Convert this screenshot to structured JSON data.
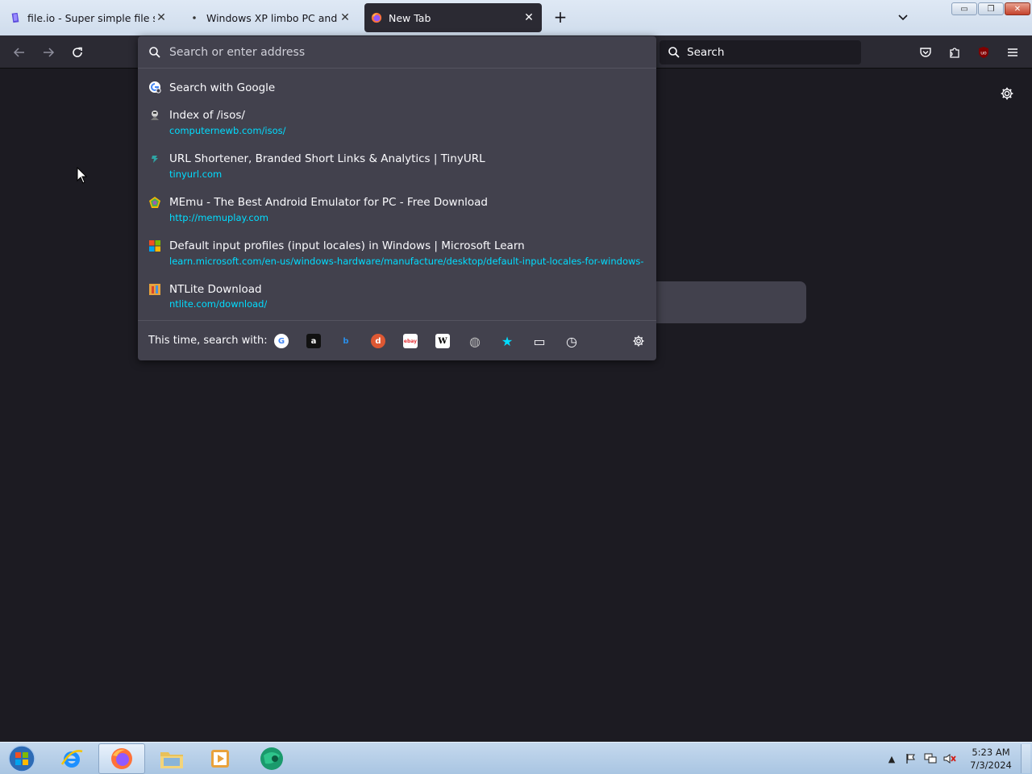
{
  "tabs": [
    {
      "title": "file.io - Super simple file sharing",
      "close": "✕"
    },
    {
      "title": "Windows XP limbo PC and JSO",
      "close": "✕"
    },
    {
      "title": "New Tab",
      "close": "✕",
      "active": true
    }
  ],
  "newtab_label": "+",
  "window_controls": {
    "minimize": "▭",
    "restore": "❐",
    "close": "✕"
  },
  "nav": {
    "search_label": "Search"
  },
  "urlbar": {
    "placeholder": "Search or enter address",
    "results": [
      {
        "title": "Search with Google",
        "url": "",
        "icon": "google-icon"
      },
      {
        "title": "Index of /isos/",
        "url": "computernewb.com/isos/",
        "icon": "site-icon"
      },
      {
        "title": "URL Shortener, Branded Short Links & Analytics | TinyURL",
        "url": "tinyurl.com",
        "icon": "tinyurl-icon"
      },
      {
        "title": "MEmu - The Best Android Emulator for PC - Free Download",
        "url": "http://memuplay.com",
        "icon": "memu-icon"
      },
      {
        "title": "Default input profiles (input locales) in Windows | Microsoft Learn",
        "url": "learn.microsoft.com/en-us/windows-hardware/manufacture/desktop/default-input-locales-for-windows-language-packs",
        "icon": "microsoft-icon"
      },
      {
        "title": "NTLite Download",
        "url": "ntlite.com/download/",
        "icon": "ntlite-icon"
      }
    ],
    "oneoff_label": "This time, search with:",
    "engines": [
      {
        "name": "google-engine-icon",
        "glyph": "G",
        "color": "#4285f4"
      },
      {
        "name": "amazon-engine-icon",
        "glyph": "a",
        "color": "#ffffff"
      },
      {
        "name": "bing-engine-icon",
        "glyph": "b",
        "color": "#2a8ee8"
      },
      {
        "name": "duckduckgo-engine-icon",
        "glyph": "d",
        "color": "#de5833"
      },
      {
        "name": "ebay-engine-icon",
        "glyph": "ebay",
        "color": "#e53238"
      },
      {
        "name": "wikipedia-engine-icon",
        "glyph": "W",
        "color": "#000000"
      },
      {
        "name": "generic-engine-icon",
        "glyph": "◍",
        "color": "#bbbbbb"
      },
      {
        "name": "bookmarks-star-icon",
        "glyph": "★",
        "color": "#00ddff"
      },
      {
        "name": "tabs-icon",
        "glyph": "▭",
        "color": "#fbfbfe"
      },
      {
        "name": "history-icon",
        "glyph": "◷",
        "color": "#fbfbfe"
      }
    ]
  },
  "taskbar": {
    "clock_time": "5:23 AM",
    "clock_date": "7/3/2024",
    "tray_arrow": "▲"
  },
  "colors": {
    "page_bg": "#1c1b22",
    "toolbar_bg": "#2b2a33",
    "panel_bg": "#42414d",
    "url_accent": "#00ddff"
  }
}
